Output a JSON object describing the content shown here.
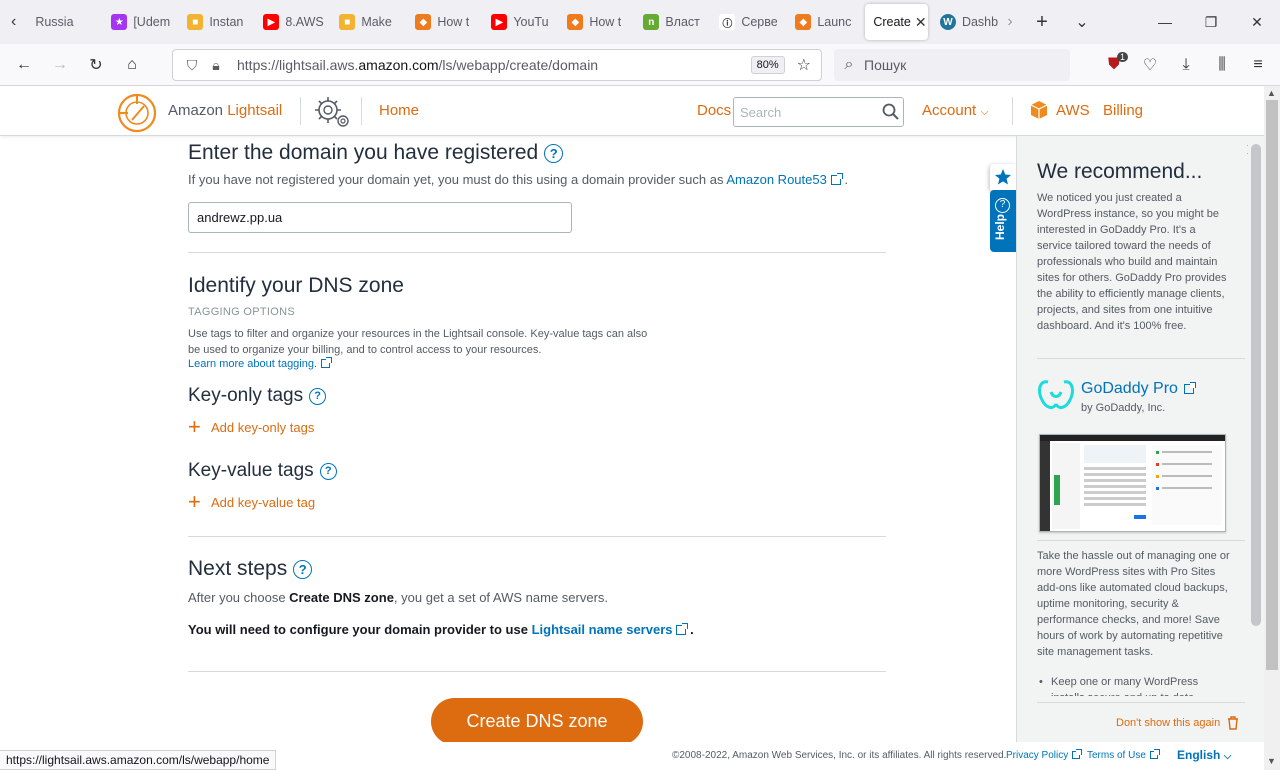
{
  "browser": {
    "tabs": [
      {
        "title": "Russia",
        "color": "#ffffff",
        "glyph": ""
      },
      {
        "title": "[Udem",
        "color": "#a435f0",
        "glyph": "★"
      },
      {
        "title": "Instan",
        "color": "#f2b430",
        "glyph": "■"
      },
      {
        "title": "8.AWS",
        "color": "#ff0000",
        "glyph": "▶"
      },
      {
        "title": "Make",
        "color": "#f2b430",
        "glyph": "■"
      },
      {
        "title": "How t",
        "color": "#ee7b1e",
        "glyph": "◆"
      },
      {
        "title": "YouTu",
        "color": "#ff0000",
        "glyph": "▶"
      },
      {
        "title": "How t",
        "color": "#ee7b1e",
        "glyph": "◆"
      },
      {
        "title": "Власт",
        "color": "#66aa33",
        "glyph": "n"
      },
      {
        "title": "Серве",
        "color": "#ffffff",
        "glyph": "ⓘ"
      },
      {
        "title": "Launc",
        "color": "#ee7b1e",
        "glyph": "◆"
      }
    ],
    "active_tab": "Create",
    "after_tab": "Dashb",
    "url_prefix": "https://lightsail.aws.",
    "url_domain": "amazon.com",
    "url_suffix": "/ls/webapp/create/domain",
    "zoom": "80%",
    "search_placeholder": "Пошук",
    "ext_badge": "1"
  },
  "header": {
    "brand_prefix": "Amazon ",
    "brand_name": "Lightsail",
    "home": "Home",
    "docs": "Docs",
    "search_placeholder": "Search",
    "account": "Account",
    "aws": "AWS",
    "billing": "Billing"
  },
  "domain_section": {
    "title": "Enter the domain you have registered",
    "desc_prefix": "If you have not registered your domain yet, you must do this using a domain provider such as",
    "route53": "Amazon Route53",
    "desc_suffix": ".",
    "domain_value": "andrewz.pp.ua"
  },
  "dns_section": {
    "title": "Identify your DNS zone",
    "tagging_label": "TAGGING OPTIONS",
    "tagging_desc_1": "Use tags to filter and organize your resources in the Lightsail console. Key-value tags can also",
    "tagging_desc_2": "be used to organize your billing, and to control access to your resources.",
    "learn_more": "Learn more about tagging.",
    "key_only_title": "Key-only tags",
    "add_key_only": "Add key-only tags",
    "key_value_title": "Key-value tags",
    "add_key_value": "Add key-value tag"
  },
  "next_steps": {
    "title": "Next steps",
    "desc_prefix": "After you choose ",
    "desc_bold": "Create DNS zone",
    "desc_suffix": ", you get a set of AWS name servers.",
    "need_prefix": "You will need to configure your domain provider to use ",
    "need_link": "Lightsail name servers",
    "need_suffix": " ."
  },
  "create_button": "Create DNS zone",
  "side": {
    "help": "Help"
  },
  "panel": {
    "title": "We recommend...",
    "intro": "We noticed you just created a WordPress instance, so you might be interested in GoDaddy Pro. It's a service tailored toward the needs of professionals who build and maintain sites for others. GoDaddy Pro provides the ability to efficiently manage clients, projects, and sites from one intuitive dashboard. And it's 100% free.",
    "product_name": "GoDaddy Pro",
    "product_by": "by GoDaddy, Inc.",
    "pro_text": "Take the hassle out of managing one or more WordPress sites with Pro Sites add-ons like automated cloud backups, uptime monitoring, security & performance checks, and more! Save hours of work by automating repetitive site management tasks.",
    "bullet": "Keep one or many WordPress installs secure and up to date",
    "dont_show": "Don't show this again"
  },
  "footer": {
    "copyright": "©2008-2022, Amazon Web Services, Inc. or its affiliates. All rights reserved.",
    "privacy": "Privacy Policy",
    "terms": "Terms of Use",
    "language": "English"
  },
  "status_url": "https://lightsail.aws.amazon.com/ls/webapp/home",
  "colors": {
    "accent_orange": "#dd6b10",
    "link_blue": "#0073bb",
    "text_dark": "#232f3e"
  }
}
